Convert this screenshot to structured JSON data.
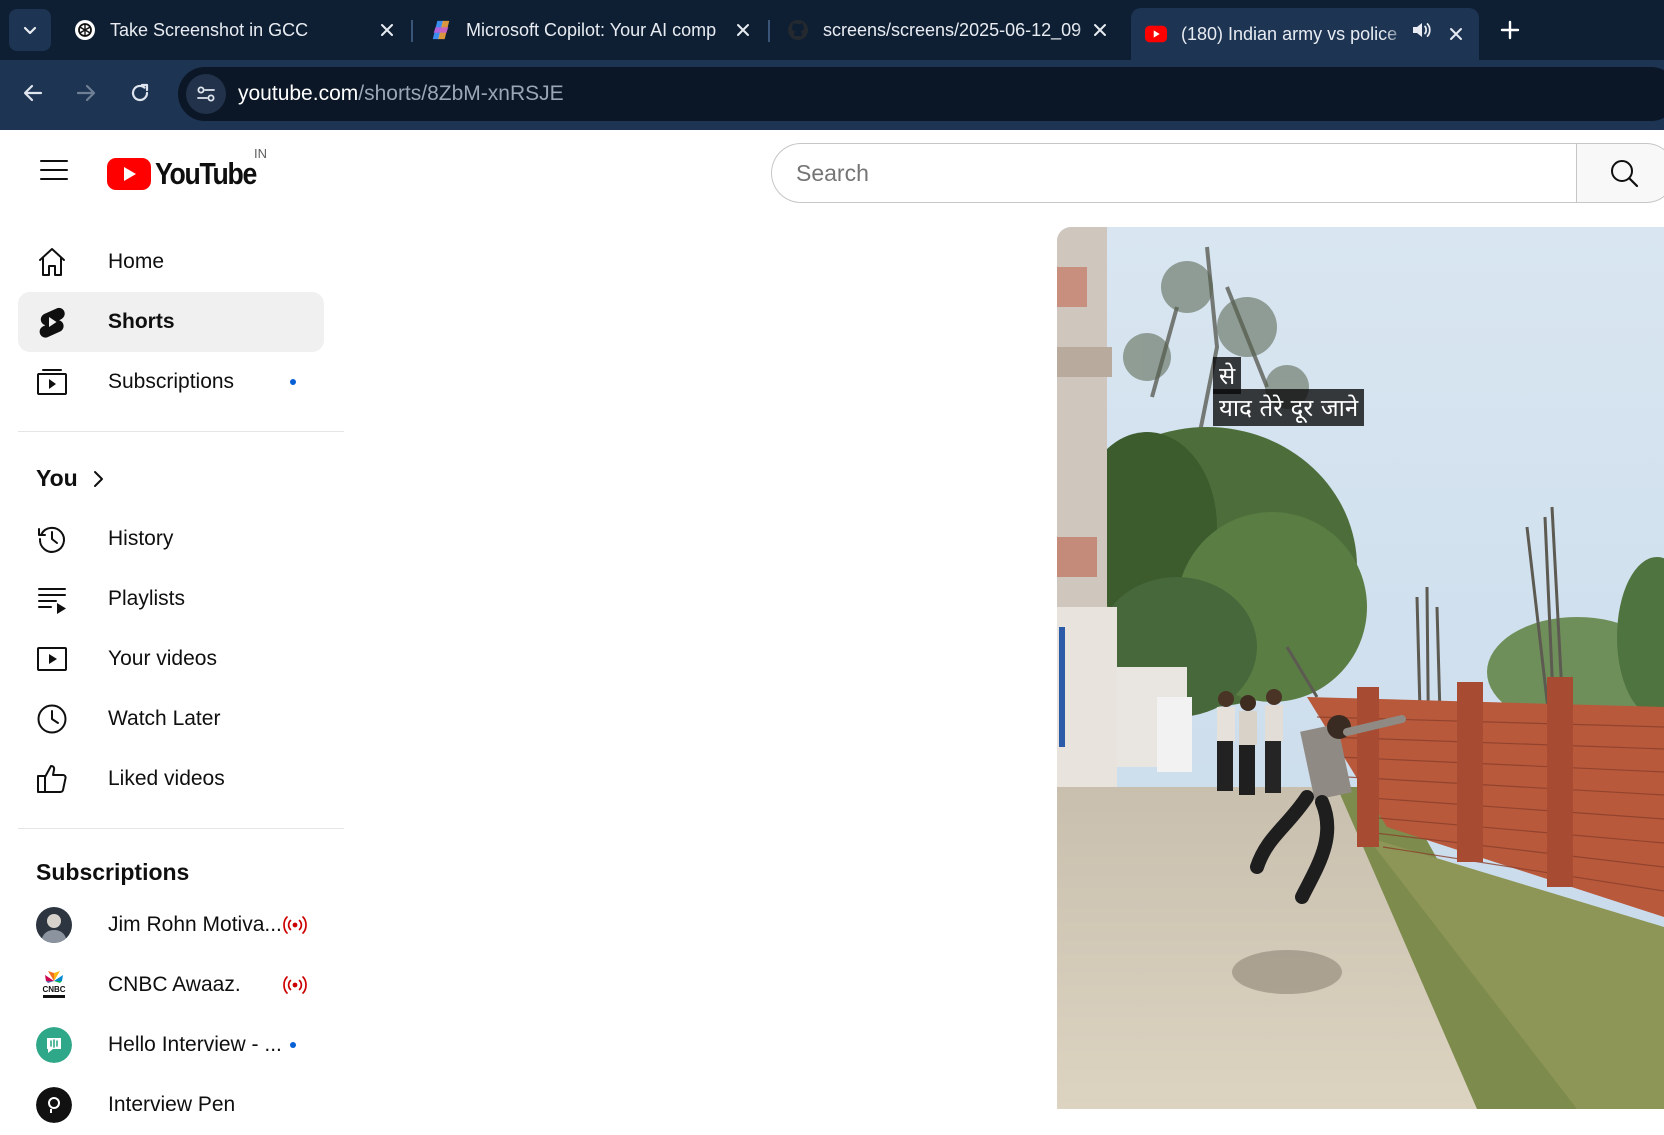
{
  "browser": {
    "tabs": [
      {
        "title": "Take Screenshot in GCC",
        "favicon": "openai-icon",
        "active": false
      },
      {
        "title": "Microsoft Copilot: Your AI comp",
        "favicon": "copilot-icon",
        "active": false
      },
      {
        "title": "screens/screens/2025-06-12_09",
        "favicon": "github-icon",
        "active": false
      },
      {
        "title": "(180) Indian army vs police",
        "favicon": "youtube-icon",
        "active": true,
        "audio": true
      }
    ],
    "address": {
      "host": "youtube.com",
      "path": "/shorts/8ZbM-xnRSJE"
    },
    "colors": {
      "frame": "#0f1f33",
      "toolbar": "#1d3453",
      "omnibox": "#0b1626"
    }
  },
  "youtube": {
    "logo_text": "YouTube",
    "country_code": "IN",
    "search_placeholder": "Search",
    "brand_red": "#ff0000"
  },
  "sidebar": {
    "primary": [
      {
        "label": "Home",
        "icon": "home-icon"
      },
      {
        "label": "Shorts",
        "icon": "shorts-icon",
        "active": true
      },
      {
        "label": "Subscriptions",
        "icon": "subscriptions-icon",
        "new_dot": true
      }
    ],
    "you_title": "You",
    "you": [
      {
        "label": "History",
        "icon": "history-icon"
      },
      {
        "label": "Playlists",
        "icon": "playlists-icon"
      },
      {
        "label": "Your videos",
        "icon": "your-videos-icon"
      },
      {
        "label": "Watch Later",
        "icon": "watch-later-icon"
      },
      {
        "label": "Liked videos",
        "icon": "thumbs-up-icon"
      }
    ],
    "subscriptions_title": "Subscriptions",
    "subscriptions": [
      {
        "label": "Jim Rohn Motiva...",
        "status": "live"
      },
      {
        "label": "CNBC Awaaz.",
        "status": "live"
      },
      {
        "label": "Hello Interview - ...",
        "status": "new"
      },
      {
        "label": "Interview Pen",
        "status": ""
      }
    ]
  },
  "video": {
    "caption_line1": "से",
    "caption_line2": "याद तेरे दूर जाने"
  }
}
